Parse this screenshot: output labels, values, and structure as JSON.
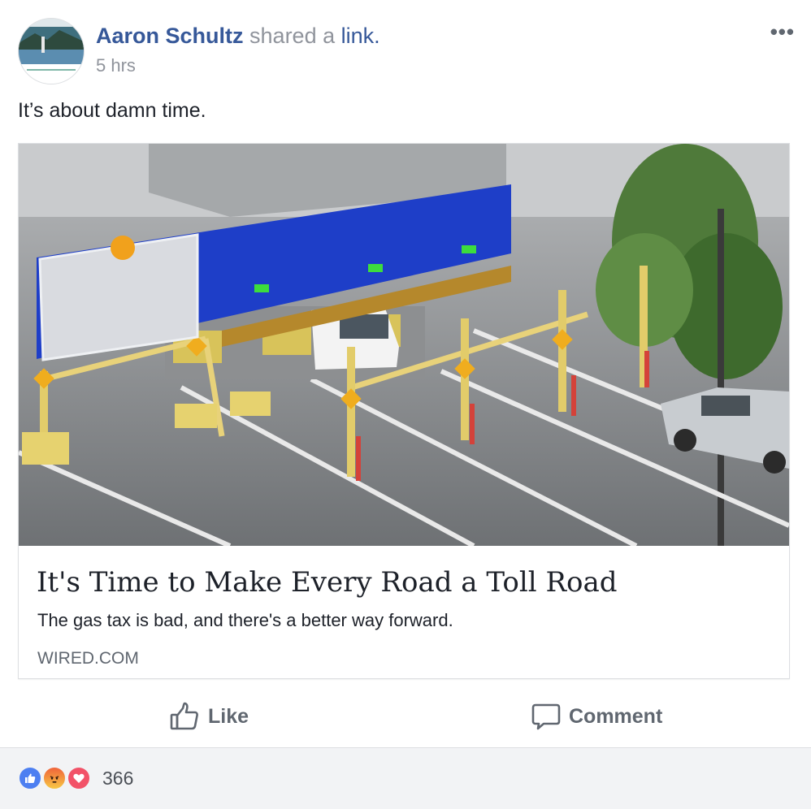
{
  "post": {
    "author": "Aaron Schultz",
    "action_text": "shared a",
    "action_link": "link.",
    "timestamp": "5 hrs",
    "more_label": "•••",
    "message": "It’s about damn time."
  },
  "link_preview": {
    "title": "It's Time to Make Every Road a Toll Road",
    "description": "The gas tax is bad, and there's a better way forward.",
    "domain": "WIRED.COM"
  },
  "actions": {
    "like_label": "Like",
    "comment_label": "Comment"
  },
  "reactions": {
    "count": "366",
    "types": [
      "like",
      "angry",
      "love"
    ]
  },
  "colors": {
    "link_blue": "#365899",
    "meta_gray": "#90949c",
    "like_blue": "#4d7ff1",
    "love_red": "#f25268",
    "angry_orange": "#f0633a",
    "toll_sign_blue": "#1e3ec8"
  },
  "icons": {
    "more": "more-options-icon",
    "like": "thumbs-up-icon",
    "comment": "speech-bubble-icon"
  }
}
